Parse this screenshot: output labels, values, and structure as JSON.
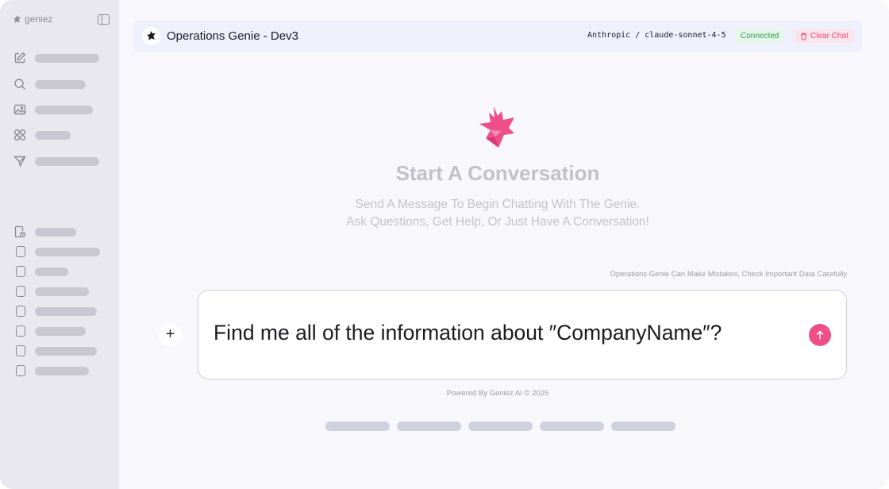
{
  "app": {
    "brand_name": "geniez",
    "brand_icon": "geniez-logo-icon"
  },
  "sidebar": {
    "toggle_icon": "sidebar-toggle-icon",
    "nav_items": [
      {
        "icon": "new-chat-icon"
      },
      {
        "icon": "search-icon"
      },
      {
        "icon": "image-icon"
      },
      {
        "icon": "apps-grid-icon"
      },
      {
        "icon": "send-filter-icon"
      }
    ],
    "history_items": [
      {
        "icon": "document-clock-icon"
      },
      {
        "icon": "document-icon"
      },
      {
        "icon": "document-icon"
      },
      {
        "icon": "document-icon"
      },
      {
        "icon": "document-icon"
      },
      {
        "icon": "document-icon"
      },
      {
        "icon": "document-icon"
      },
      {
        "icon": "document-icon"
      }
    ]
  },
  "header": {
    "title": "Operations Genie - Dev3",
    "model": "Anthropic / claude-sonnet-4-5",
    "status": "Connected",
    "clear_label": "Clear Chat"
  },
  "welcome": {
    "title": "Start A Conversation",
    "subtitle_line1": "Send A Message To Begin Chatting With The Genie.",
    "subtitle_line2": "Ask Questions, Get Help, Or Just Have A Conversation!"
  },
  "composer": {
    "disclaimer": "Operations Genie Can Make Mistakes, Check Important Data Carefully",
    "input_value": "Find me all of the information about ″CompanyName″?",
    "attach_label": "+"
  },
  "footer": {
    "powered_by": "Powered By Geniez AI © 2025"
  },
  "colors": {
    "accent": "#ef4f87",
    "status_green": "#2f9e55",
    "sidebar_bg": "#e9e8ef",
    "header_bg": "#eef0fb"
  }
}
